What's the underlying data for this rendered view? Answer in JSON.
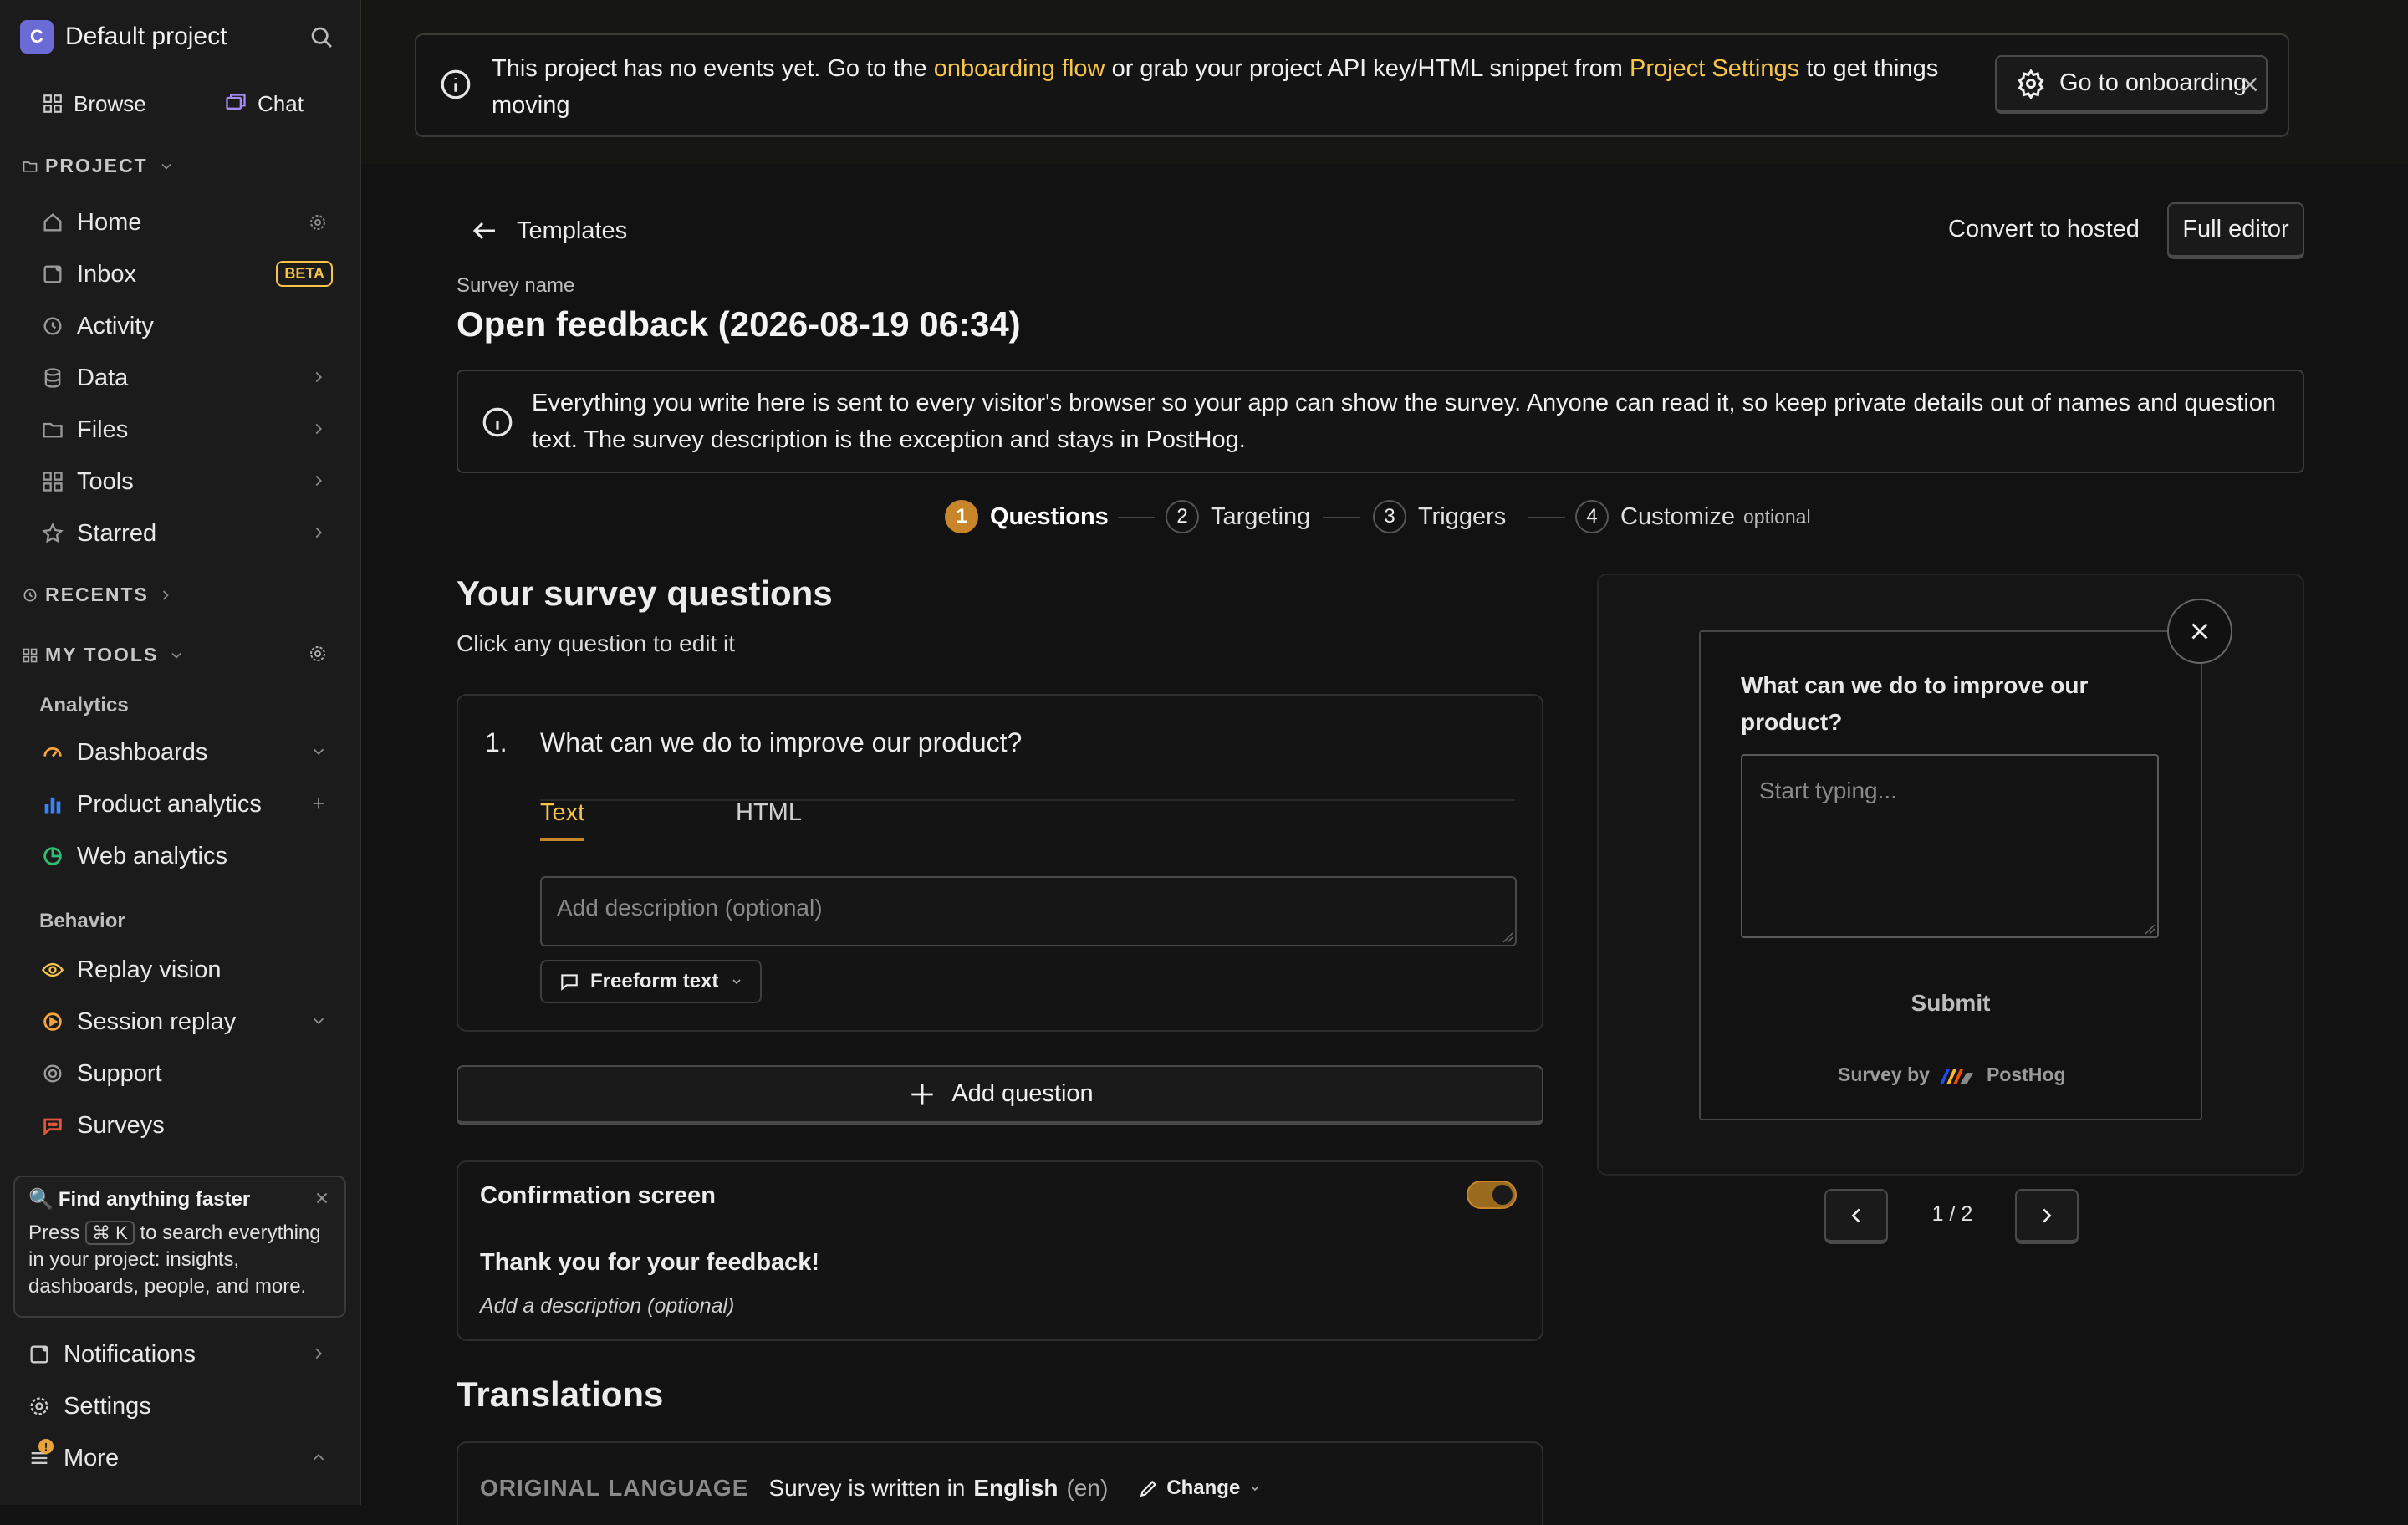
{
  "sidebar": {
    "project_initial": "C",
    "project_name": "Default project",
    "browse": "Browse",
    "chat": "Chat",
    "project_section": "PROJECT",
    "items": [
      {
        "label": "Home"
      },
      {
        "label": "Inbox",
        "badge": "BETA"
      },
      {
        "label": "Activity"
      },
      {
        "label": "Data"
      },
      {
        "label": "Files"
      },
      {
        "label": "Tools"
      },
      {
        "label": "Starred"
      }
    ],
    "recents_section": "RECENTS",
    "my_tools_section": "MY TOOLS",
    "analytics_head": "Analytics",
    "analytics": [
      {
        "label": "Dashboards"
      },
      {
        "label": "Product analytics"
      },
      {
        "label": "Web analytics"
      }
    ],
    "behavior_head": "Behavior",
    "behavior": [
      {
        "label": "Replay vision"
      },
      {
        "label": "Session replay"
      },
      {
        "label": "Support"
      },
      {
        "label": "Surveys"
      }
    ],
    "tip": {
      "title": "Find anything faster",
      "press": "Press",
      "key": "⌘ K",
      "rest": "to search everything in your project: insights, dashboards, people, and more."
    },
    "notifications": "Notifications",
    "settings": "Settings",
    "more": "More",
    "more_badge": "!"
  },
  "banner": {
    "text_before": "This project has no events yet. Go to the",
    "link1": "onboarding flow",
    "text_mid": "or grab your project API key/HTML snippet from",
    "link2": "Project Settings",
    "text_after": "to get things moving",
    "button": "Go to onboarding"
  },
  "header": {
    "back_label": "Templates",
    "convert": "Convert to hosted",
    "full_editor": "Full editor"
  },
  "survey": {
    "name_label": "Survey name",
    "name": "Open feedback (2026-08-19 06:34)",
    "notice": "Everything you write here is sent to every visitor's browser so your app can show the survey. Anyone can read it, so keep private details out of names and question text. The survey description is the exception and stays in PostHog."
  },
  "steps": [
    {
      "num": "1",
      "label": "Questions"
    },
    {
      "num": "2",
      "label": "Targeting"
    },
    {
      "num": "3",
      "label": "Triggers"
    },
    {
      "num": "4",
      "label": "Customize",
      "extra": "optional"
    }
  ],
  "questions": {
    "title": "Your survey questions",
    "subtitle": "Click any question to edit it",
    "q1": {
      "num": "1.",
      "text": "What can we do to improve our product?",
      "tab_text": "Text",
      "tab_html": "HTML",
      "desc_placeholder": "Add description (optional)",
      "type": "Freeform text"
    },
    "add": "Add question"
  },
  "confirmation": {
    "title": "Confirmation screen",
    "thanks": "Thank you for your feedback!",
    "desc": "Add a description (optional)"
  },
  "translations": {
    "title": "Translations",
    "orig_label": "ORIGINAL LANGUAGE",
    "written": "Survey is written in",
    "lang": "English",
    "code": "(en)",
    "change": "Change"
  },
  "preview": {
    "question": "What can we do to improve our product?",
    "placeholder": "Start typing...",
    "submit": "Submit",
    "survey_by": "Survey by",
    "brand": "PostHog",
    "pager": "1 / 2"
  },
  "colors": {
    "accent": "#f6c54a",
    "orange": "#c9852a"
  }
}
